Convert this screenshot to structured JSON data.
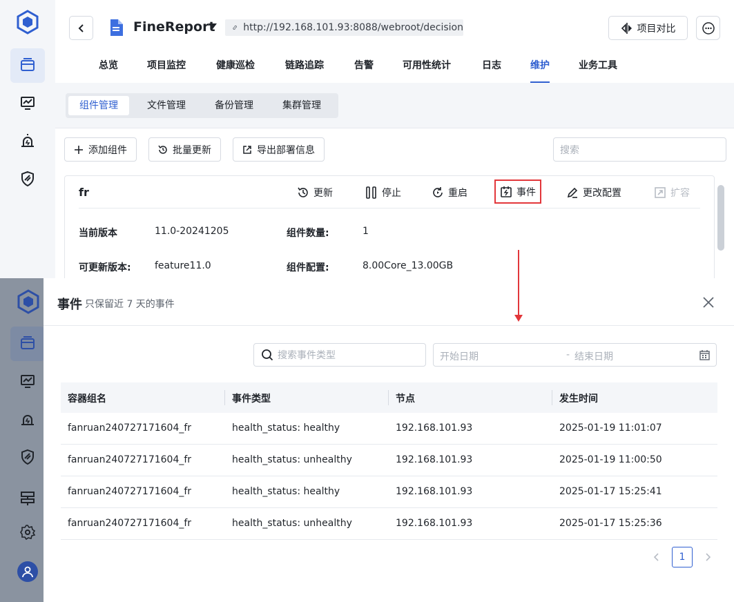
{
  "colors": {
    "accent": "#2f5fd0",
    "highlight_red": "#e2363a",
    "bg_gray": "#f4f6f9",
    "dim_sidebar": "#8a93a0"
  },
  "sidebar": {
    "items": [
      {
        "icon": "layers-icon"
      },
      {
        "icon": "monitor-chart-icon"
      },
      {
        "icon": "alarm-icon"
      },
      {
        "icon": "shield-icon"
      }
    ]
  },
  "header": {
    "app_title": "FineReport",
    "url": "http://192.168.101.93:8088/webroot/decision",
    "compare_label": "项目对比"
  },
  "nav": {
    "tabs": [
      {
        "label": "总览"
      },
      {
        "label": "项目监控"
      },
      {
        "label": "健康巡检"
      },
      {
        "label": "链路追踪"
      },
      {
        "label": "告警"
      },
      {
        "label": "可用性统计"
      },
      {
        "label": "日志"
      },
      {
        "label": "维护"
      },
      {
        "label": "业务工具"
      }
    ],
    "active": "维护"
  },
  "subtabs": {
    "items": [
      {
        "label": "组件管理"
      },
      {
        "label": "文件管理"
      },
      {
        "label": "备份管理"
      },
      {
        "label": "集群管理"
      }
    ]
  },
  "toolbar": {
    "add": "添加组件",
    "batch_update": "批量更新",
    "export": "导出部署信息",
    "search_placeholder": "搜索"
  },
  "component_card": {
    "name": "fr",
    "actions": {
      "update": "更新",
      "stop": "停止",
      "restart": "重启",
      "events": "事件",
      "change_config": "更改配置",
      "scale": "扩容"
    },
    "current_version_label": "当前版本",
    "current_version": "11.0-20241205",
    "count_label": "组件数量:",
    "count": "1",
    "updatable_label": "可更新版本:",
    "updatable": "feature11.0",
    "config_label": "组件配置:",
    "config": "8.00Core_13.00GB"
  },
  "drawer": {
    "title": "事件",
    "subtitle": "只保留近 7 天的事件",
    "search_placeholder": "搜索事件类型",
    "date_start_placeholder": "开始日期",
    "date_sep": "-",
    "date_end_placeholder": "结束日期",
    "columns": [
      "容器组名",
      "事件类型",
      "节点",
      "发生时间"
    ],
    "rows": [
      [
        "fanruan240727171604_fr",
        "health_status: healthy",
        "192.168.101.93",
        "2025-01-19 11:01:07"
      ],
      [
        "fanruan240727171604_fr",
        "health_status: unhealthy",
        "192.168.101.93",
        "2025-01-19 11:00:50"
      ],
      [
        "fanruan240727171604_fr",
        "health_status: healthy",
        "192.168.101.93",
        "2025-01-17 15:25:41"
      ],
      [
        "fanruan240727171604_fr",
        "health_status: unhealthy",
        "192.168.101.93",
        "2025-01-17 15:25:36"
      ]
    ],
    "page": "1"
  }
}
